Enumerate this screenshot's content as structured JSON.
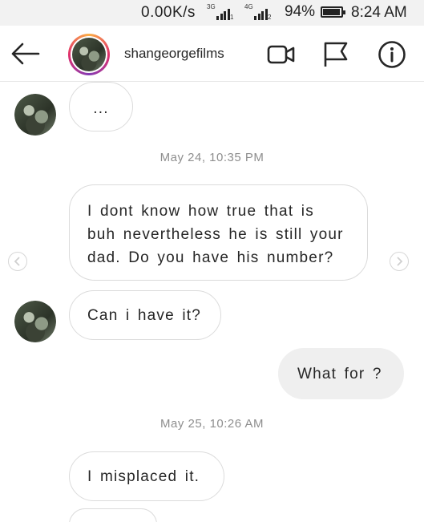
{
  "status_bar": {
    "speed": "0.00K/s",
    "net1": "3G",
    "sim1": "1",
    "net2": "4G",
    "sim2": "2",
    "battery_pct": "94%",
    "battery_level": 0.94,
    "time": "8:24 AM"
  },
  "header": {
    "username": "shangeorgefilms",
    "icons": [
      "back-arrow-icon",
      "video-call-icon",
      "flag-icon",
      "info-icon"
    ]
  },
  "messages": [
    {
      "from": "them",
      "text": "..."
    },
    {
      "type": "timestamp",
      "text": "May 24, 10:35 PM"
    },
    {
      "from": "them",
      "lines": [
        "I dont know how true that is",
        "buh nevertheless he is still your",
        "dad. Do you have his number?"
      ]
    },
    {
      "from": "them",
      "text": "Can i have it?"
    },
    {
      "from": "me",
      "text": "What for ?"
    },
    {
      "type": "timestamp",
      "text": "May 25, 10:26 AM"
    },
    {
      "from": "them",
      "text": "I misplaced it."
    }
  ],
  "colors": {
    "status_bar_bg": "#f2f2f2",
    "bubble_border": "#dbdbdb",
    "sent_bubble_bg": "#efefef",
    "timestamp": "#8e8e8e"
  }
}
